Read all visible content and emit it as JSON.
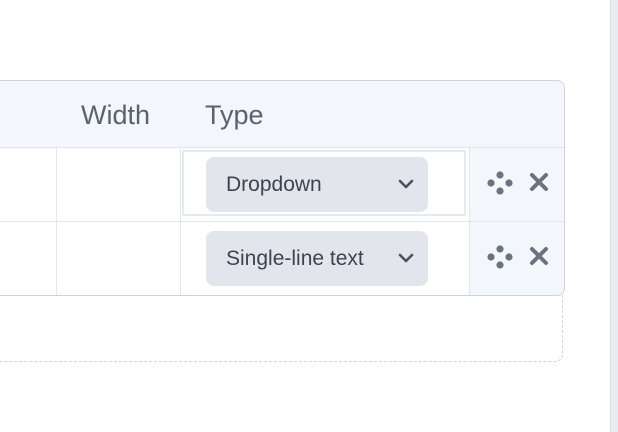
{
  "table": {
    "headers": {
      "width": "Width",
      "type": "Type"
    },
    "rows": [
      {
        "type_value": "Dropdown"
      },
      {
        "type_value": "Single-line text"
      }
    ]
  },
  "icons": {
    "select": "chevron-down-icon",
    "drag": "drag-handle-icon",
    "remove": "close-icon"
  },
  "colors": {
    "header_bg": "#f3f6fb",
    "select_bg": "#e2e6ec",
    "icon": "#6b7380",
    "border": "#cdd3dc"
  }
}
